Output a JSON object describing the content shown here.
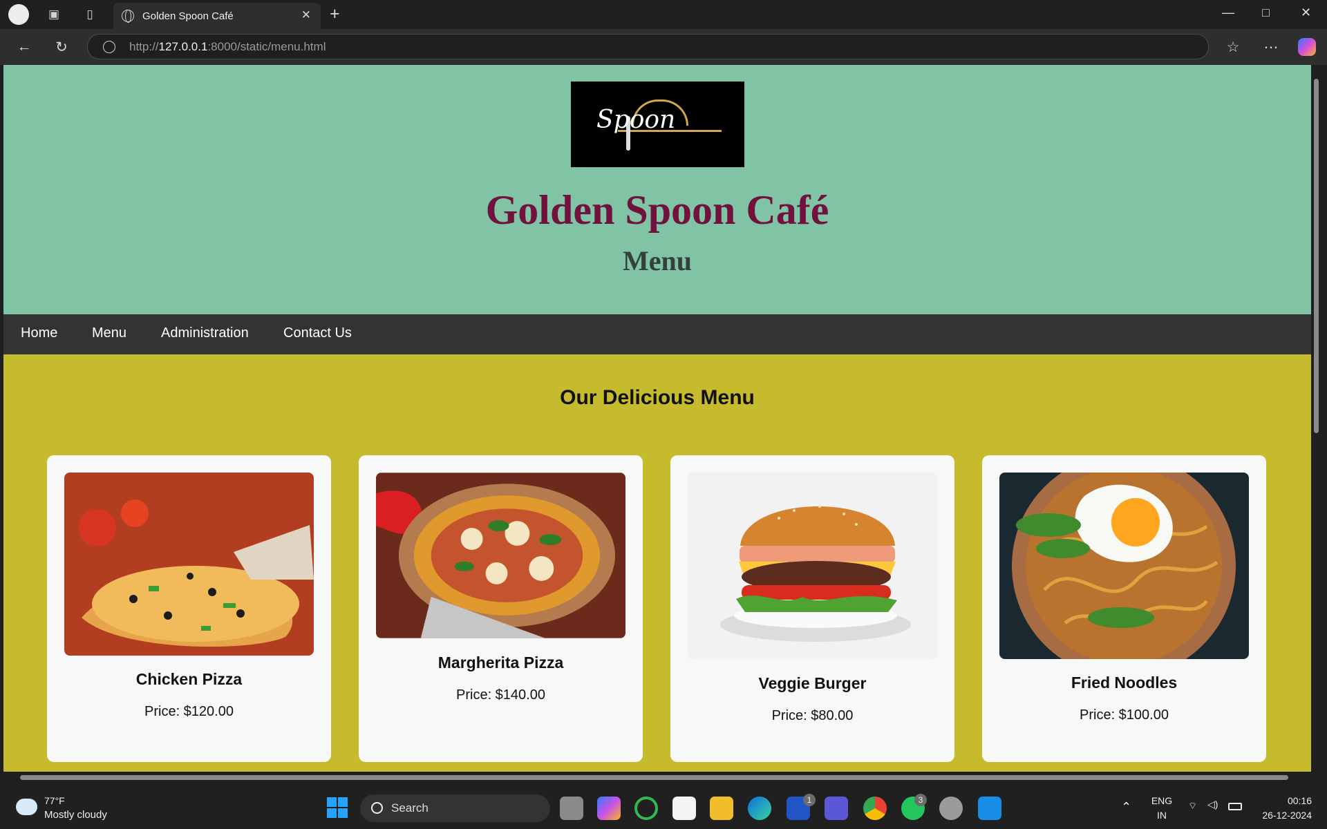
{
  "browser": {
    "tab_title": "Golden Spoon Café",
    "url_prefix": "http://",
    "url_host": "127.0.0.1",
    "url_suffix": ":8000/static/menu.html"
  },
  "header": {
    "logo_text": "Spoon",
    "site_title": "Golden Spoon Café",
    "page_title": "Menu"
  },
  "nav": {
    "items": [
      "Home",
      "Menu",
      "Administration",
      "Contact Us"
    ]
  },
  "menu": {
    "heading": "Our Delicious Menu",
    "items": [
      {
        "name": "Chicken Pizza",
        "price": "Price: $120.00"
      },
      {
        "name": "Margherita Pizza",
        "price": "Price: $140.00"
      },
      {
        "name": "Veggie Burger",
        "price": "Price: $80.00"
      },
      {
        "name": "Fried Noodles",
        "price": "Price: $100.00"
      }
    ]
  },
  "taskbar": {
    "temperature": "77°F",
    "weather": "Mostly cloudy",
    "search_label": "Search",
    "language": "ENG",
    "region": "IN",
    "time": "00:16",
    "date": "26-12-2024",
    "badges": [
      "1",
      "3"
    ]
  },
  "colors": {
    "header_background": "#80c3a5",
    "site_title": "#70123d",
    "content_background": "#c6ba2d",
    "navigation": "#333333"
  },
  "icons": [
    "profile-icon",
    "workspaces-icon",
    "tab-actions-icon",
    "globe-icon",
    "close-icon",
    "add-tab-icon",
    "back-icon",
    "refresh-icon",
    "favorites-icon",
    "more-icon",
    "copilot-icon",
    "weather-icon",
    "windows-start-icon",
    "search-icon"
  ]
}
